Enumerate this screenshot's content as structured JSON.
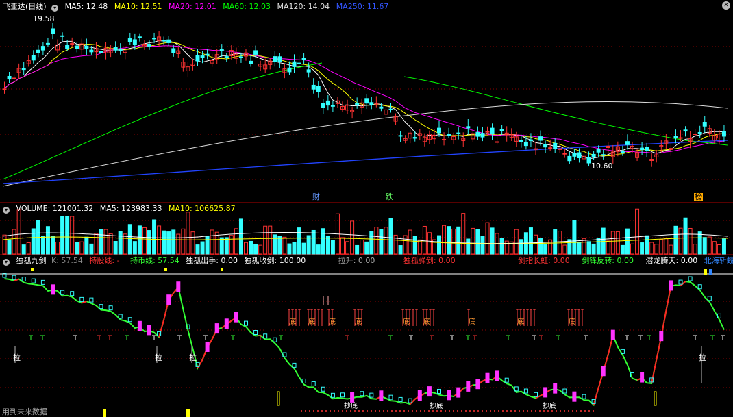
{
  "main": {
    "title": "飞亚达(日线)",
    "ma": [
      {
        "label": "MA5: 12.48",
        "color": "#ffffff"
      },
      {
        "label": "MA10: 12.51",
        "color": "#ffff00"
      },
      {
        "label": "MA20: 12.01",
        "color": "#ff00ff"
      },
      {
        "label": "MA60: 12.03",
        "color": "#00ff00"
      },
      {
        "label": "MA120: 14.04",
        "color": "#e0e0e0"
      },
      {
        "label": "MA250: 11.67",
        "color": "#3355ff"
      }
    ],
    "high_label": "19.58",
    "low_label": "10.60",
    "events": [
      {
        "text": "财",
        "color": "#6699ff"
      },
      {
        "text": "跌",
        "color": "#66ff66"
      },
      {
        "text": "榜",
        "color": "#000000",
        "bg": "#ffaa00"
      }
    ]
  },
  "volume": {
    "title": "VOLUME: 121001.32",
    "ma5": "MA5: 123983.33",
    "ma10": "MA10: 106625.87"
  },
  "indicator": {
    "title": "独孤九剑",
    "fields": [
      {
        "label": "K: 57.54",
        "color": "#888888"
      },
      {
        "label": "持股线: -",
        "color": "#ff3333"
      },
      {
        "label": "持币线: 57.54",
        "color": "#33ff33"
      },
      {
        "label": "独孤出手: 0.00",
        "color": "#ffffff"
      },
      {
        "label": "独孤收剑: 100.00",
        "color": "#ffffff"
      },
      {
        "label": "拉升: 0.00",
        "color": "#aaaaaa"
      },
      {
        "label": "独孤弹剑: 0.00",
        "color": "#ff3333"
      },
      {
        "label": "剑指长虹: 0.00",
        "color": "#ff3333"
      },
      {
        "label": "剑锋反转: 0.00",
        "color": "#33ff33"
      },
      {
        "label": "潜龙腾天: 0.00",
        "color": "#ffffff"
      },
      {
        "label": "北海斩蛟",
        "color": "#3388ff"
      }
    ],
    "marks": {
      "la": "拉",
      "di": "底",
      "chaodi": "抄底"
    },
    "footer": "用到未来数据"
  },
  "colors": {
    "up": "#ff3333",
    "down": "#33ffff",
    "grid": "#8b0000",
    "panel_border": "#b00000"
  }
}
